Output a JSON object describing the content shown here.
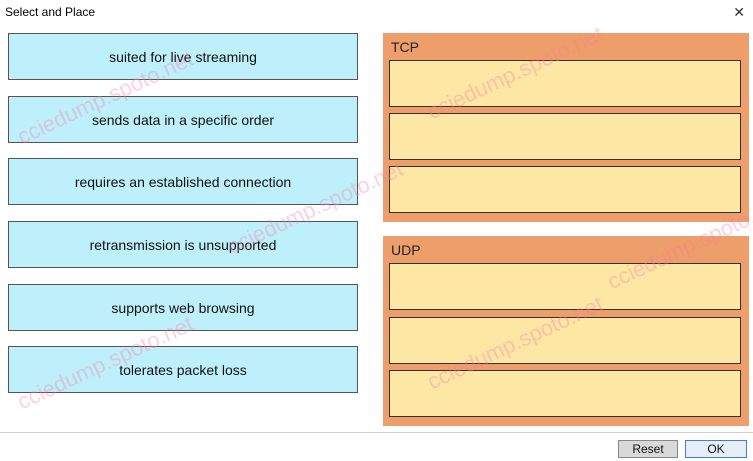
{
  "window": {
    "title": "Select and Place",
    "close_icon": "close-icon"
  },
  "items": [
    {
      "label": "suited for live streaming"
    },
    {
      "label": "sends data in a specific order"
    },
    {
      "label": "requires an established connection"
    },
    {
      "label": "retransmission is unsupported"
    },
    {
      "label": "supports web browsing"
    },
    {
      "label": "tolerates packet loss"
    }
  ],
  "targets": [
    {
      "label": "TCP",
      "slots": 3
    },
    {
      "label": "UDP",
      "slots": 3
    }
  ],
  "buttons": {
    "reset": "Reset",
    "ok": "OK"
  },
  "watermark": {
    "text": "cciedump.spoto.net"
  },
  "colors": {
    "item_bg": "#bdf0fb",
    "panel_bg": "#ee9e6a",
    "slot_bg": "#fde7a4",
    "ok_border": "#3c7fd8"
  }
}
